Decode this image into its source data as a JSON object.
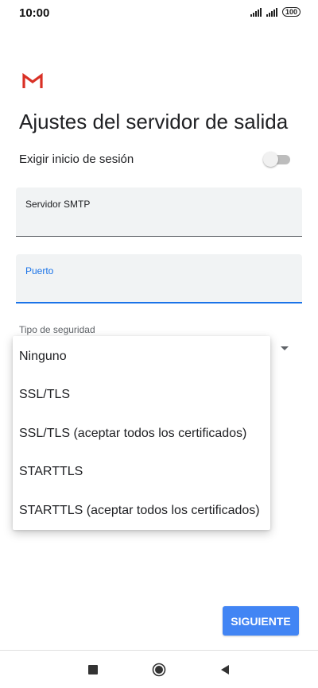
{
  "status_bar": {
    "time": "10:00",
    "battery": "100"
  },
  "app": {
    "logo_icon": "gmail-m-icon"
  },
  "page": {
    "title": "Ajustes del servidor de salida"
  },
  "login": {
    "label": "Exigir inicio de sesión",
    "enabled": false
  },
  "fields": {
    "smtp_label": "Servidor SMTP",
    "smtp_value": "",
    "port_label": "Puerto",
    "port_value": ""
  },
  "security": {
    "label": "Tipo de seguridad",
    "options": [
      "Ninguno",
      "SSL/TLS",
      "SSL/TLS (aceptar todos los certificados)",
      "STARTTLS",
      "STARTTLS (aceptar todos los certificados)"
    ]
  },
  "actions": {
    "next_label": "SIGUIENTE"
  },
  "nav_bar": {
    "icons": [
      "recents-square-icon",
      "home-circle-icon",
      "back-triangle-icon"
    ]
  },
  "colors": {
    "accent": "#1a73e8",
    "button": "#4285f4",
    "gmail_red": "#d93025"
  }
}
